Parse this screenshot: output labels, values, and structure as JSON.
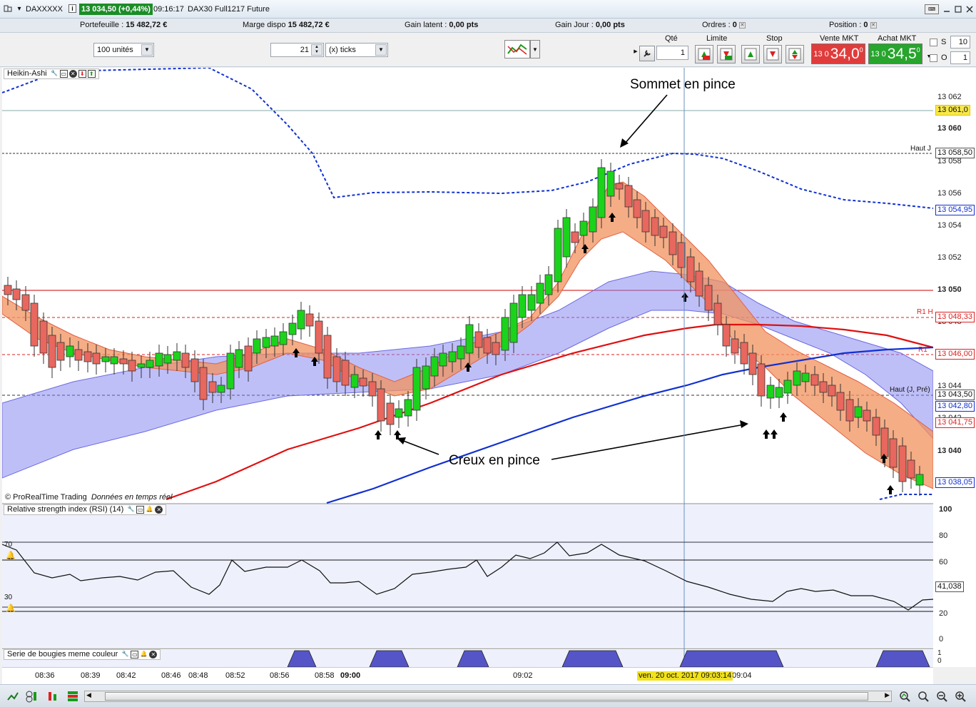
{
  "titlebar": {
    "instrument": "DAXXXXX",
    "price_badge": "13 034,50 (+0,44%)",
    "time": "09:16:17",
    "contract": "DAX30 Full1217 Future"
  },
  "infobar": {
    "portefeuille_label": "Portefeuille :",
    "portefeuille_value": "15 482,72 €",
    "marge_label": "Marge dispo",
    "marge_value": "15 482,72 €",
    "gain_latent_label": "Gain latent :",
    "gain_latent_value": "0,00 pts",
    "gain_jour_label": "Gain Jour :",
    "gain_jour_value": "0,00 pts",
    "ordres_label": "Ordres :",
    "ordres_value": "0",
    "position_label": "Position :",
    "position_value": "0"
  },
  "toolbar": {
    "units_select": "100 unités",
    "ticks_value": "21",
    "ticks_select": "(x) ticks"
  },
  "order_panel": {
    "qte_label": "Qté",
    "qte_value": "1",
    "limite_label": "Limite",
    "stop_label": "Stop",
    "vente_label": "Vente MKT",
    "achat_label": "Achat MKT",
    "vente_small": "13 0",
    "vente_big": "34,0",
    "vente_sup": "0",
    "achat_small": "13 0",
    "achat_big": "34,5",
    "achat_sup": "0",
    "s_label": "S",
    "s_value": "10",
    "o_label": "O",
    "o_value": "1"
  },
  "price_panel": {
    "title": "Heikin-Ashi",
    "copyright": "© ProRealTime Trading",
    "realtime": "Données en temps réel",
    "y_ticks": [
      "13 062",
      "13 060",
      "13 058",
      "13 056",
      "13 054",
      "13 052",
      "13 050",
      "13 048",
      "13 046",
      "13 044",
      "13 042",
      "13 040",
      "13 038"
    ],
    "level_labels": {
      "haut_j": "Haut J",
      "r1h": "R1 H",
      "r1": "R1",
      "haut_j_pre": "Haut (J, Pré)"
    },
    "badges": {
      "b1": "13 061,0",
      "b2": "13 058,50",
      "b3": "13 054,95",
      "b4": "13 048,33",
      "b5": "13 046,00",
      "b6": "13 043,50",
      "b7": "13 042,80",
      "b8": "13 041,75",
      "b9": "13 038,05"
    },
    "colors": {
      "bull": "#1bd31b",
      "bear": "#e8675e",
      "blue_band": "#7f7ff2",
      "orange_band": "#f2925e",
      "red_ma": "#e01010",
      "blue_ma": "#1030d0"
    }
  },
  "annotations": {
    "sommet": "Sommet en pince",
    "creux": "Creux en pince"
  },
  "rsi_panel": {
    "title": "Relative strength index (RSI) (14)",
    "level_70": "70",
    "level_30": "30",
    "y_ticks": [
      "100",
      "80",
      "60",
      "40",
      "20",
      "0"
    ],
    "value_badge": "41,038"
  },
  "bottom_panel": {
    "title": "Serie de bougies meme couleur",
    "y_ticks": [
      "1",
      "0"
    ]
  },
  "time_axis": {
    "labels": [
      "08:36",
      "08:39",
      "08:42",
      "08:46",
      "08:48",
      "08:52",
      "08:56",
      "08:58",
      "09:00",
      "09:02",
      "09:04"
    ],
    "cursor_date": "ven. 20 oct. 2017 09:03:14"
  }
}
